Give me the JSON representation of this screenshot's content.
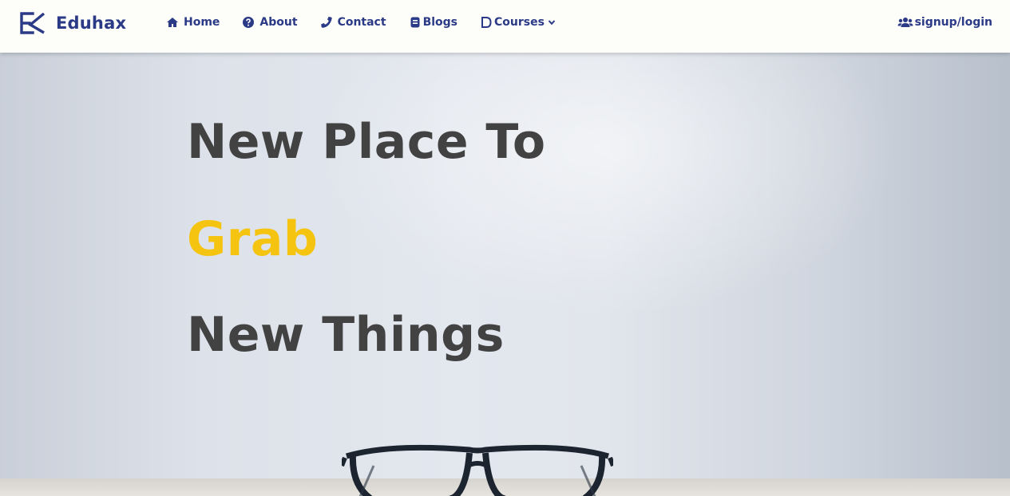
{
  "brand": {
    "name": "Eduhax",
    "logo_icon": "ek-logo-icon"
  },
  "nav": {
    "items": [
      {
        "label": "Home",
        "icon": "home-icon"
      },
      {
        "label": "About",
        "icon": "question-circle-icon"
      },
      {
        "label": "Contact",
        "icon": "phone-icon"
      },
      {
        "label": "Blogs",
        "icon": "blog-icon"
      },
      {
        "label": "Courses",
        "icon": "course-icon",
        "dropdown": true
      }
    ],
    "auth_label": "signup/login",
    "auth_icon": "users-icon"
  },
  "hero": {
    "line1": "New Place To",
    "line2": "Grab",
    "line3": "New Things"
  },
  "colors": {
    "brand": "#2b3a86",
    "accent": "#f5c411",
    "headline": "#424242",
    "navbar_bg": "#fdfdf9"
  }
}
